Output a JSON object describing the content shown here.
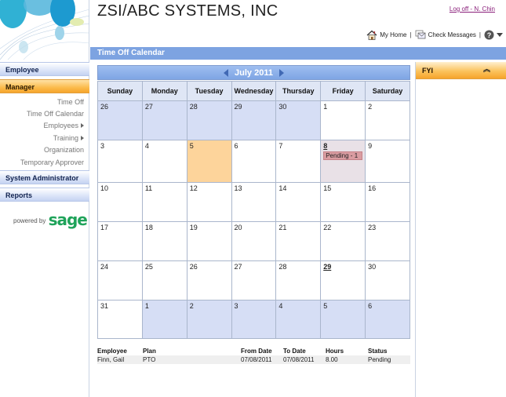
{
  "header": {
    "company": "ZSI/ABC SYSTEMS, INC",
    "logoff": "Log off - N. Chin",
    "my_home": "My Home",
    "check_messages": "Check Messages"
  },
  "page_title": "Time Off Calendar",
  "sidebar": {
    "sections": {
      "employee": "Employee",
      "manager": "Manager",
      "system_admin": "System Administrator",
      "reports": "Reports"
    },
    "manager_items": {
      "time_off": "Time Off",
      "time_off_calendar": "Time Off Calendar",
      "employees": "Employees",
      "training": "Training",
      "organization": "Organization",
      "temporary_approver": "Temporary Approver"
    },
    "powered_by": "powered by",
    "brand": "sage"
  },
  "calendar": {
    "month_label": "July 2011",
    "weekdays": [
      "Sunday",
      "Monday",
      "Tuesday",
      "Wednesday",
      "Thursday",
      "Friday",
      "Saturday"
    ],
    "weeks": [
      [
        {
          "d": "26",
          "t": "other"
        },
        {
          "d": "27",
          "t": "other"
        },
        {
          "d": "28",
          "t": "other"
        },
        {
          "d": "29",
          "t": "other"
        },
        {
          "d": "30",
          "t": "other"
        },
        {
          "d": "1",
          "t": ""
        },
        {
          "d": "2",
          "t": ""
        }
      ],
      [
        {
          "d": "3",
          "t": ""
        },
        {
          "d": "4",
          "t": ""
        },
        {
          "d": "5",
          "t": "today"
        },
        {
          "d": "6",
          "t": ""
        },
        {
          "d": "7",
          "t": ""
        },
        {
          "d": "8",
          "t": "has-event bold-day",
          "event": "Pending - 1"
        },
        {
          "d": "9",
          "t": ""
        }
      ],
      [
        {
          "d": "10",
          "t": ""
        },
        {
          "d": "11",
          "t": ""
        },
        {
          "d": "12",
          "t": ""
        },
        {
          "d": "13",
          "t": ""
        },
        {
          "d": "14",
          "t": ""
        },
        {
          "d": "15",
          "t": ""
        },
        {
          "d": "16",
          "t": ""
        }
      ],
      [
        {
          "d": "17",
          "t": ""
        },
        {
          "d": "18",
          "t": ""
        },
        {
          "d": "19",
          "t": ""
        },
        {
          "d": "20",
          "t": ""
        },
        {
          "d": "21",
          "t": ""
        },
        {
          "d": "22",
          "t": ""
        },
        {
          "d": "23",
          "t": ""
        }
      ],
      [
        {
          "d": "24",
          "t": ""
        },
        {
          "d": "25",
          "t": ""
        },
        {
          "d": "26",
          "t": ""
        },
        {
          "d": "27",
          "t": ""
        },
        {
          "d": "28",
          "t": ""
        },
        {
          "d": "29",
          "t": "bold-day"
        },
        {
          "d": "30",
          "t": ""
        }
      ],
      [
        {
          "d": "31",
          "t": ""
        },
        {
          "d": "1",
          "t": "other"
        },
        {
          "d": "2",
          "t": "other"
        },
        {
          "d": "3",
          "t": "other"
        },
        {
          "d": "4",
          "t": "other"
        },
        {
          "d": "5",
          "t": "other"
        },
        {
          "d": "6",
          "t": "other"
        }
      ]
    ]
  },
  "details": {
    "columns": [
      "Employee",
      "Plan",
      "From Date",
      "To Date",
      "Hours",
      "Status"
    ],
    "rows": [
      [
        "Finn, Gail",
        "PTO",
        "07/08/2011",
        "07/08/2011",
        "8.00",
        "Pending"
      ]
    ]
  },
  "fyi": {
    "title": "FYI"
  },
  "colors": {
    "title_bar": "#7da3e1",
    "active_nav": "#fbbb4c",
    "today": "#fdd49b",
    "other_month": "#d6def5",
    "pending": "#d99ca1"
  }
}
